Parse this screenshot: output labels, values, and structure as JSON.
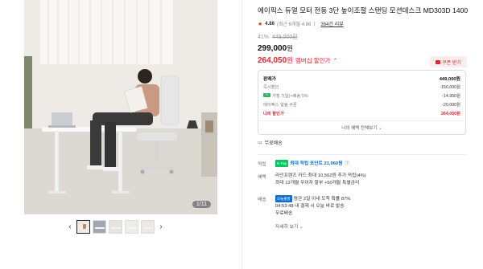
{
  "gallery": {
    "counter": "1/11",
    "thumb_count": 5,
    "prev_icon": "chevron-left-icon",
    "next_icon": "chevron-right-icon"
  },
  "product": {
    "title": "에이픽스 듀얼 모터 전동 3단 높이조절 스탠딩 모션데스크 MD303D 1400",
    "rating": "4.88",
    "rating_detail": "(최근 6개월 4.86",
    "rating_star": "★",
    "review": "364건 리뷰",
    "discount_pct": "41%",
    "original_price": "449,000원",
    "price": "299,000",
    "price_unit": "원",
    "member_price": "264,050",
    "member_unit": "원",
    "member_label": "멤버십 할인가",
    "coupon_button": "쿠폰 받기"
  },
  "breakdown": {
    "rows": [
      {
        "label": "판매가",
        "value": "449,000원"
      },
      {
        "label": "즉시할인",
        "value": "-150,000원"
      },
      {
        "label": "가장 7(일)+배송 5%",
        "value": "-14,950원"
      },
      {
        "label": "에이픽스 알림 쿠폰",
        "value": "-20,000원"
      }
    ],
    "final_label": "나의 할인가",
    "final_value": "264,050원",
    "all_benefits": "나의 혜택 전체보기 ⌄"
  },
  "shipping_note": "무료배송",
  "info": {
    "points_key": "적립",
    "points_badge": "N Pay",
    "points_text": "최대 적립 포인트 21,960원",
    "points_mag": "ⓘ",
    "benefit_key": "혜택",
    "benefit_line1": "라인프렌즈 카드 최대 10,562원 추가 적립(4%)",
    "benefit_line2": "최대 12개월 무이자 할부 +50개월 특별금리",
    "delivery_key": "배송",
    "today_badge": "오늘출발",
    "delivery_line1": "평균 2일 이내 도착 확률 87%",
    "delivery_line2": "04:53:48 내 결제 시 오늘 바로 발송",
    "delivery_line3": "무료배송",
    "detail_link": "자세히 보기 ⌄"
  },
  "colors": {
    "accent": "#e0272d",
    "point": "#0e6fd1",
    "naver": "#03c75a"
  }
}
